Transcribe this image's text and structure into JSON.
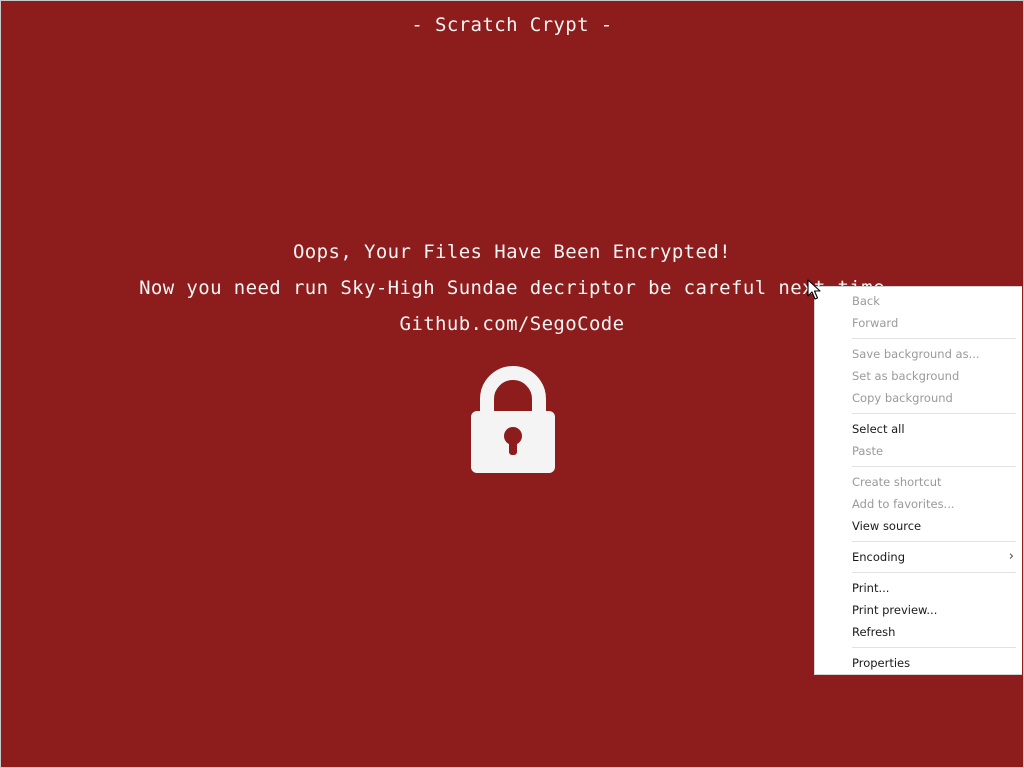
{
  "page": {
    "title": "- Scratch Crypt -",
    "headline": "Oops, Your Files Have Been Encrypted!",
    "subline": "Now you need run Sky-High Sundae decriptor be careful next time",
    "link": "Github.com/SegoCode",
    "background_color": "#8d1c1c",
    "text_color": "#f4f4f4",
    "lock_icon": "padlock-icon"
  },
  "context_menu": {
    "back": "Back",
    "forward": "Forward",
    "save_background": "Save background as...",
    "set_background": "Set as background",
    "copy_background": "Copy background",
    "select_all": "Select all",
    "paste": "Paste",
    "create_shortcut": "Create shortcut",
    "add_favorites": "Add to favorites...",
    "view_source": "View source",
    "encoding": "Encoding",
    "encoding_arrow": "›",
    "print": "Print...",
    "print_preview": "Print preview...",
    "refresh": "Refresh",
    "properties": "Properties"
  }
}
